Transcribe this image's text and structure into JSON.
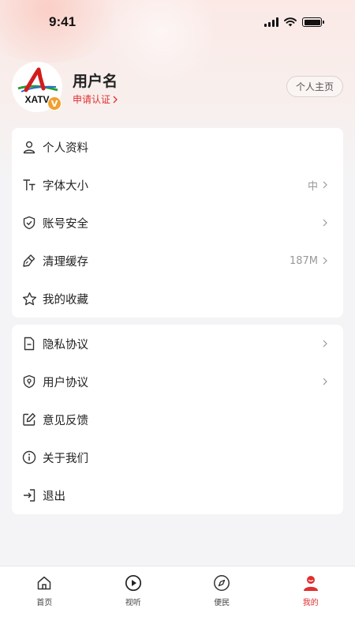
{
  "status_bar": {
    "time": "9:41"
  },
  "profile": {
    "username": "用户名",
    "verify_label": "申请认证",
    "homepage_label": "个人主页",
    "badge_text": "V",
    "avatar_text": "XATV"
  },
  "menu_group_1": [
    {
      "label": "个人资料",
      "value": "",
      "icon": "user-icon"
    },
    {
      "label": "字体大小",
      "value": "中",
      "icon": "font-size-icon"
    },
    {
      "label": "账号安全",
      "value": "",
      "icon": "shield-check-icon"
    },
    {
      "label": "清理缓存",
      "value": "187M",
      "icon": "broom-icon"
    },
    {
      "label": "我的收藏",
      "value": "",
      "icon": "star-icon"
    }
  ],
  "menu_group_2": [
    {
      "label": "隐私协议",
      "value": "",
      "icon": "document-icon"
    },
    {
      "label": "用户协议",
      "value": "",
      "icon": "shield-lock-icon"
    },
    {
      "label": "意见反馈",
      "value": "",
      "icon": "edit-icon"
    },
    {
      "label": "关于我们",
      "value": "",
      "icon": "info-icon"
    },
    {
      "label": "退出",
      "value": "",
      "icon": "logout-icon"
    }
  ],
  "tabbar": [
    {
      "label": "首页",
      "icon": "home-icon",
      "active": false
    },
    {
      "label": "视听",
      "icon": "play-icon",
      "active": false
    },
    {
      "label": "便民",
      "icon": "compass-icon",
      "active": false
    },
    {
      "label": "我的",
      "icon": "person-icon",
      "active": true
    }
  ],
  "colors": {
    "accent": "#e02f2f",
    "badge": "#f0a030",
    "text_primary": "#222222",
    "text_secondary": "#999999"
  }
}
